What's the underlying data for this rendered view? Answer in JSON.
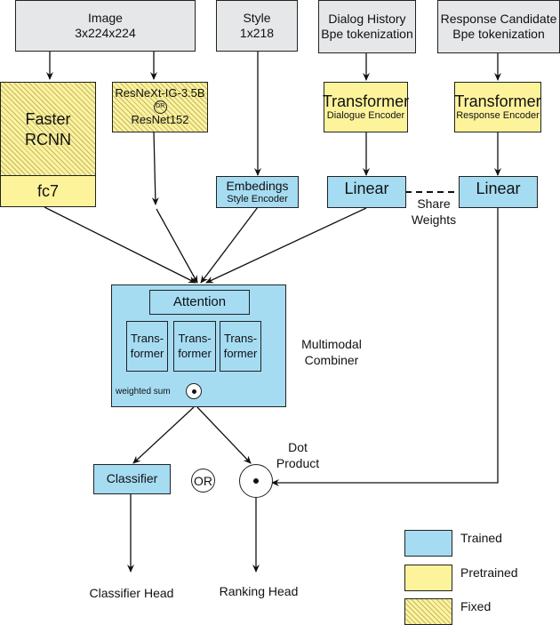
{
  "inputs": {
    "image": {
      "title": "Image",
      "shape": "3x224x224"
    },
    "style": {
      "title": "Style",
      "shape": "1x218"
    },
    "dialog": {
      "title": "Dialog History",
      "subtitle": "Bpe tokenization"
    },
    "response": {
      "title": "Response Candidate",
      "subtitle": "Bpe tokenization"
    }
  },
  "encoders": {
    "faster_rcnn": {
      "title": "Faster RCNN",
      "sub": "fc7"
    },
    "resnext": {
      "line1": "ResNeXt-IG-3.5B",
      "or": "OR",
      "line2": "ResNet152"
    },
    "style_enc": {
      "title": "Embedings",
      "sub": "Style Encoder"
    },
    "dialog_enc": {
      "title": "Transformer",
      "sub": "Dialogue Encoder"
    },
    "response_enc": {
      "title": "Transformer",
      "sub": "Response Encoder"
    },
    "linear_dialog": "Linear",
    "linear_response": "Linear",
    "share_weights": "Share Weights"
  },
  "combiner": {
    "attention": "Attention",
    "transformers": [
      "Trans-former",
      "Trans-former",
      "Trans-former"
    ],
    "weighted_sum": "weighted sum",
    "label": "Multimodal Combiner"
  },
  "heads": {
    "classifier": "Classifier",
    "or": "OR",
    "dot_product": "Dot Product",
    "classifier_head": "Classifier Head",
    "ranking_head": "Ranking Head"
  },
  "legend": [
    {
      "label": "Trained",
      "color": "#a5dcf2"
    },
    {
      "label": "Pretrained",
      "color": "#fdf39b"
    },
    {
      "label": "Fixed",
      "color": "#fdf39b"
    }
  ]
}
